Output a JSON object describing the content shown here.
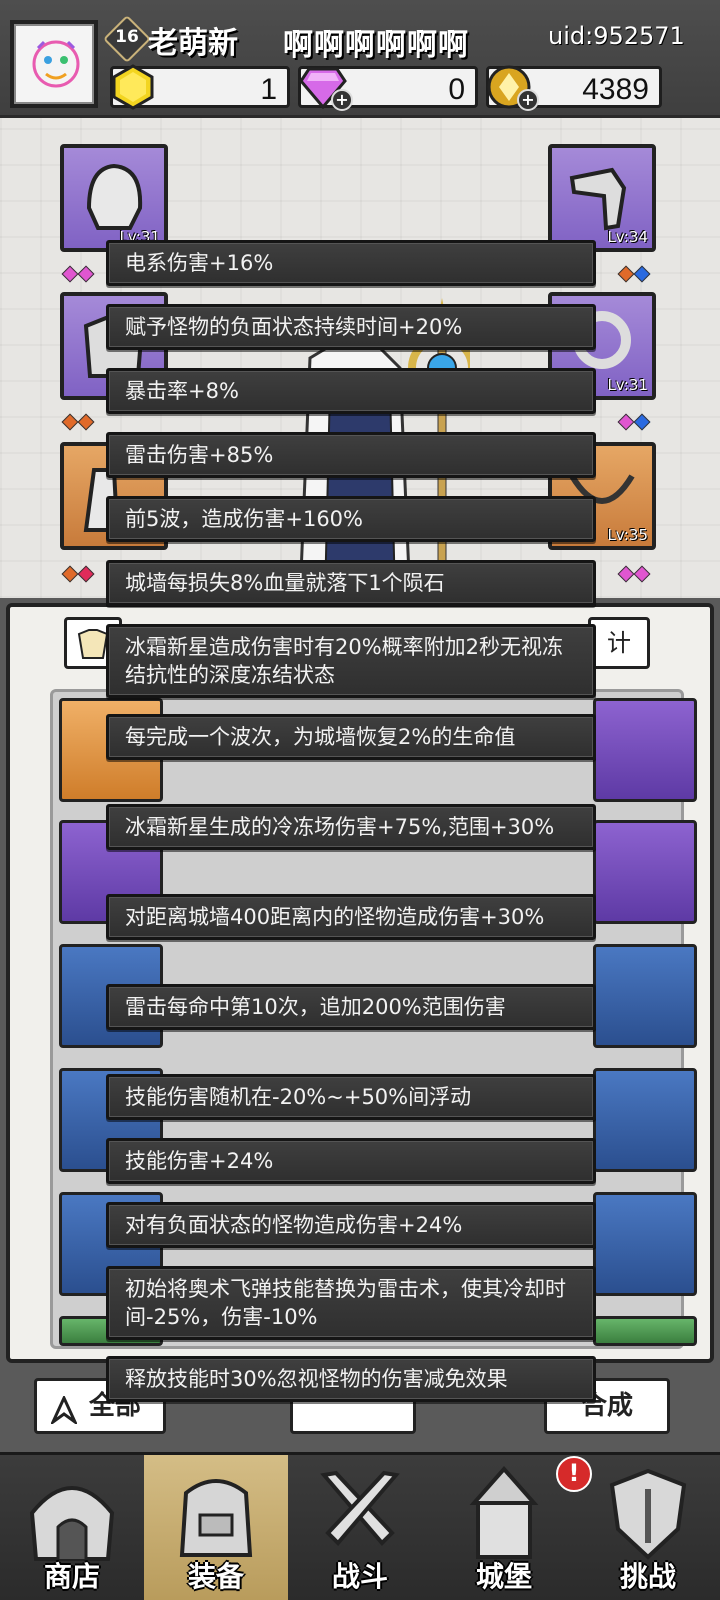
{
  "header": {
    "level": "16",
    "player_name": "老萌新",
    "guild_name": "啊啊啊啊啊啊",
    "uid": "uid:952571",
    "resources": [
      {
        "name": "gold-hexagon-icon",
        "value": "1"
      },
      {
        "name": "purple-diamond-icon",
        "value": "0"
      },
      {
        "name": "coin-icon",
        "value": "4389"
      }
    ]
  },
  "equipment": {
    "slots": [
      {
        "lv": "Lv:31"
      },
      {
        "lv": "Lv:34"
      },
      {
        "lv": "Lv:31"
      },
      {
        "lv": "Lv:35"
      }
    ]
  },
  "bag": {
    "stats_button": "计",
    "filter_all": "全部",
    "merge_button": "合成"
  },
  "tooltip_lines": [
    "电系伤害+16%",
    "赋予怪物的负面状态持续时间+20%",
    "暴击率+8%",
    "雷击伤害+85%",
    "前5波，造成伤害+160%",
    "城墙每损失8%血量就落下1个陨石",
    "冰霜新星造成伤害时有20%概率附加2秒无视冻结抗性的深度冻结状态",
    "每完成一个波次，为城墙恢复2%的生命值",
    "冰霜新星生成的冷冻场伤害+75%,范围+30%",
    "对距离城墙400距离内的怪物造成伤害+30%",
    "雷击每命中第10次，追加200%范围伤害",
    "技能伤害随机在-20%~+50%间浮动",
    "技能伤害+24%",
    "对有负面状态的怪物造成伤害+24%",
    "初始将奥术飞弹技能替换为雷击术，使其冷却时间-25%，伤害-10%",
    "释放技能时30%忽视怪物的伤害减免效果"
  ],
  "nav": {
    "items": [
      {
        "label": "商店",
        "icon": "shop-icon"
      },
      {
        "label": "装备",
        "icon": "backpack-icon"
      },
      {
        "label": "战斗",
        "icon": "crossed-swords-icon"
      },
      {
        "label": "城堡",
        "icon": "castle-icon"
      },
      {
        "label": "挑战",
        "icon": "shield-icon"
      }
    ],
    "notification": "!"
  },
  "colors": {
    "tooltip_bg": "#353535",
    "active_tab": "#c9ad6e",
    "purple_slot": "#8f72cf",
    "orange_slot": "#d98e48"
  }
}
